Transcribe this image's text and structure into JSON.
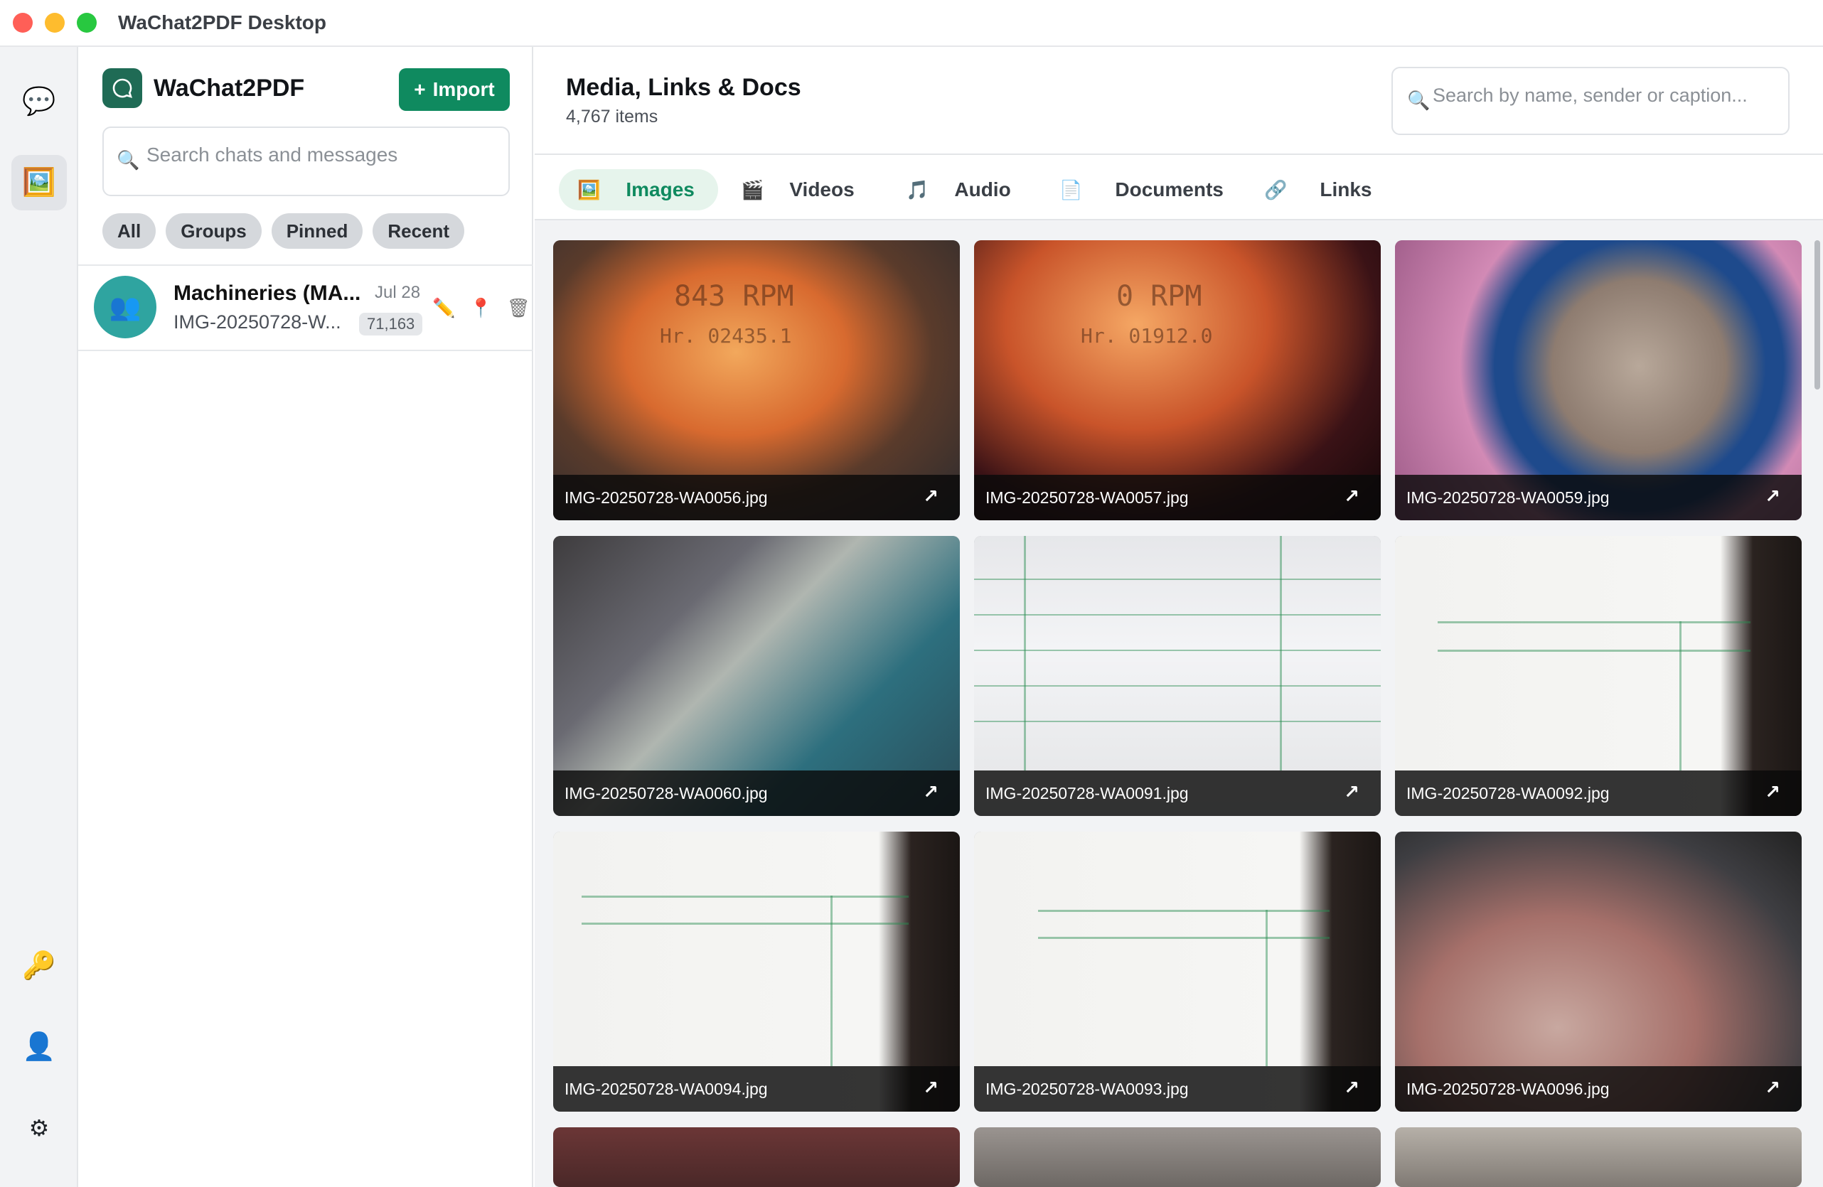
{
  "window": {
    "title": "WaChat2PDF Desktop"
  },
  "rail": {
    "top": [
      {
        "name": "chats",
        "icon": "💬",
        "active": false
      },
      {
        "name": "media",
        "icon": "🖼️",
        "active": true
      }
    ],
    "bottom": [
      {
        "name": "key",
        "icon": "🔑"
      },
      {
        "name": "profile",
        "icon": "👤"
      },
      {
        "name": "settings",
        "icon": "⚙"
      }
    ]
  },
  "sidebar": {
    "brand": "WaChat2PDF",
    "import_label": "Import",
    "import_icon": "+",
    "search_placeholder": "Search chats and messages",
    "filters": [
      "All",
      "Groups",
      "Pinned",
      "Recent"
    ],
    "chats": [
      {
        "name": "Machineries (MA...",
        "date": "Jul 28",
        "preview": "IMG-20250728-W...",
        "count": "71,163",
        "avatar_icon": "👥"
      }
    ]
  },
  "main": {
    "title": "Media, Links & Docs",
    "count": "4,767 items",
    "search_placeholder": "Search by name, sender or caption...",
    "tabs": [
      {
        "label": "Images",
        "icon": "🖼️"
      },
      {
        "label": "Videos",
        "icon": "🎬"
      },
      {
        "label": "Audio",
        "icon": "🎵"
      },
      {
        "label": "Documents",
        "icon": "📄"
      },
      {
        "label": "Links",
        "icon": "🔗"
      }
    ],
    "open_icon": "↗",
    "images": [
      "IMG-20250728-WA0056.jpg",
      "IMG-20250728-WA0057.jpg",
      "IMG-20250728-WA0059.jpg",
      "IMG-20250728-WA0060.jpg",
      "IMG-20250728-WA0091.jpg",
      "IMG-20250728-WA0092.jpg",
      "IMG-20250728-WA0094.jpg",
      "IMG-20250728-WA0093.jpg",
      "IMG-20250728-WA0096.jpg"
    ],
    "gauge_texts": {
      "rpm1": "843 RPM",
      "hr1": "Hr. 02435.1",
      "rpm2": "0 RPM",
      "hr2": "Hr. 01912.0"
    }
  },
  "colors": {
    "accent": "#0f8a5f",
    "accent_bg": "#e6f4ec",
    "brand_logo": "#1f6b55"
  }
}
